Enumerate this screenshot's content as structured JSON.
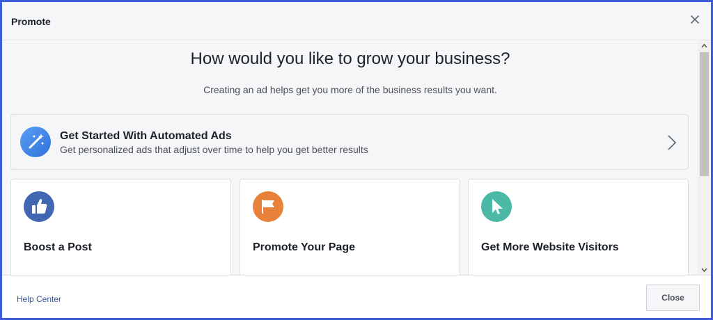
{
  "dialog": {
    "title": "Promote"
  },
  "main": {
    "headline": "How would you like to grow your business?",
    "subheadline": "Creating an ad helps get you more of the business results you want.",
    "automated_ads": {
      "title": "Get Started With Automated Ads",
      "description": "Get personalized ads that adjust over time to help you get better results",
      "icon": "magic-wand-icon",
      "icon_color": "#3b82e8"
    },
    "options": [
      {
        "title": "Boost a Post",
        "icon": "thumbs-up-icon",
        "icon_color": "#4267b2"
      },
      {
        "title": "Promote Your Page",
        "icon": "flag-icon",
        "icon_color": "#e8823a"
      },
      {
        "title": "Get More Website Visitors",
        "icon": "cursor-icon",
        "icon_color": "#4cb8a6"
      }
    ]
  },
  "footer": {
    "help_link": "Help Center",
    "close_label": "Close"
  },
  "colors": {
    "frame_border": "#3b5bdb",
    "link": "#365899"
  }
}
